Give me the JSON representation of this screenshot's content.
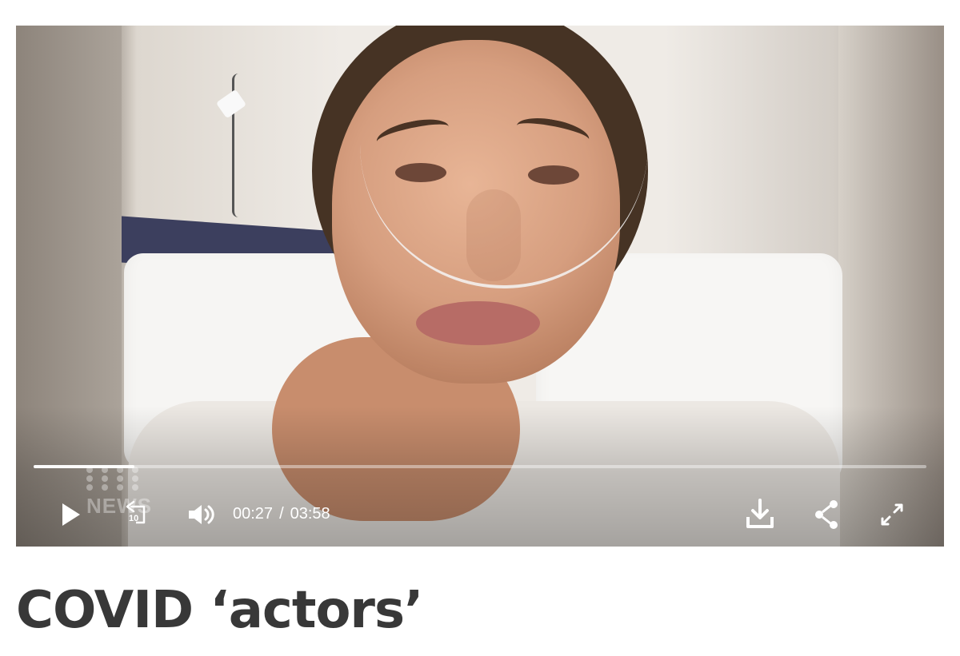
{
  "video": {
    "progress_fraction": 0.113,
    "watermark": "NEWS",
    "time_current": "00:27",
    "time_separator": "/",
    "time_total": "03:58",
    "rewind_seconds": "10",
    "icons": {
      "play": "play-icon",
      "rewind": "rewind-10-icon",
      "volume": "volume-icon",
      "download": "download-icon",
      "share": "share-icon",
      "fullscreen": "fullscreen-icon"
    }
  },
  "article": {
    "title": "COVID ‘actors’"
  }
}
